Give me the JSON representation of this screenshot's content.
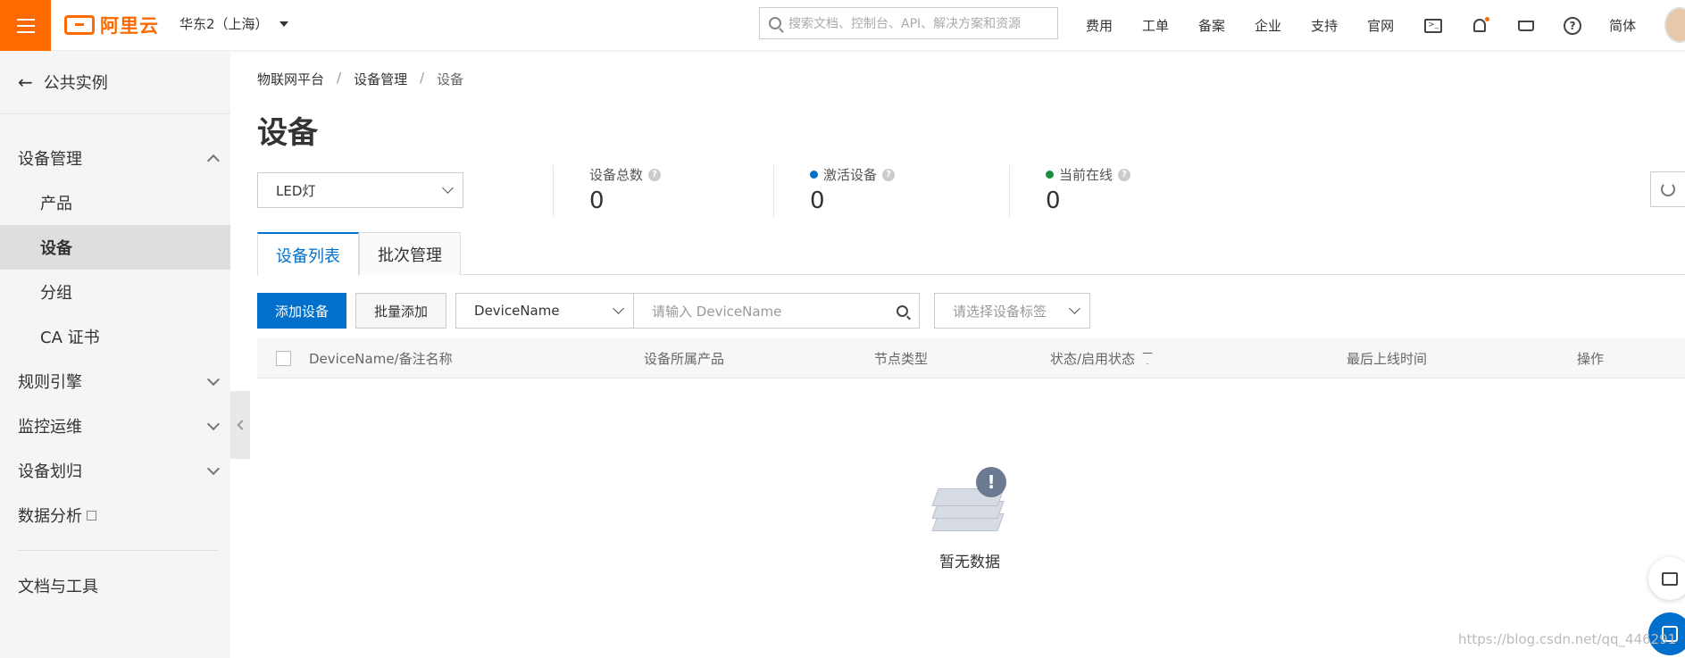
{
  "topbar": {
    "brand": "阿里云",
    "region": "华东2（上海）",
    "search_placeholder": "搜索文档、控制台、API、解决方案和资源",
    "nav": [
      "费用",
      "工单",
      "备案",
      "企业",
      "支持",
      "官网"
    ],
    "lang": "简体"
  },
  "sidebar": {
    "back_label": "公共实例",
    "groups": [
      {
        "label": "设备管理",
        "expanded": true,
        "children": [
          "产品",
          "设备",
          "分组",
          "CA 证书"
        ]
      },
      {
        "label": "规则引擎",
        "expanded": false
      },
      {
        "label": "监控运维",
        "expanded": false
      },
      {
        "label": "设备划归",
        "expanded": false
      },
      {
        "label": "数据分析"
      }
    ],
    "active_item": "设备",
    "footer_label": "文档与工具"
  },
  "breadcrumb": [
    "物联网平台",
    "设备管理",
    "设备"
  ],
  "breadcrumb_sep": "/",
  "page_title": "设备",
  "product_select": {
    "value": "LED灯"
  },
  "stats": [
    {
      "label": "设备总数",
      "value": "0"
    },
    {
      "label": "激活设备",
      "value": "0",
      "dot_color": "#0070cc"
    },
    {
      "label": "当前在线",
      "value": "0",
      "dot_color": "#1e8e3e"
    }
  ],
  "tabs": [
    "设备列表",
    "批次管理"
  ],
  "toolbar": {
    "add_label": "添加设备",
    "batch_add_label": "批量添加",
    "field_select": "DeviceName",
    "input_placeholder": "请输入 DeviceName",
    "tag_placeholder": "请选择设备标签"
  },
  "table": {
    "columns": [
      "DeviceName/备注名称",
      "设备所属产品",
      "节点类型",
      "状态/启用状态",
      "最后上线时间",
      "操作"
    ],
    "empty_text": "暂无数据"
  },
  "watermark": "https://blog.csdn.net/qq_446291"
}
